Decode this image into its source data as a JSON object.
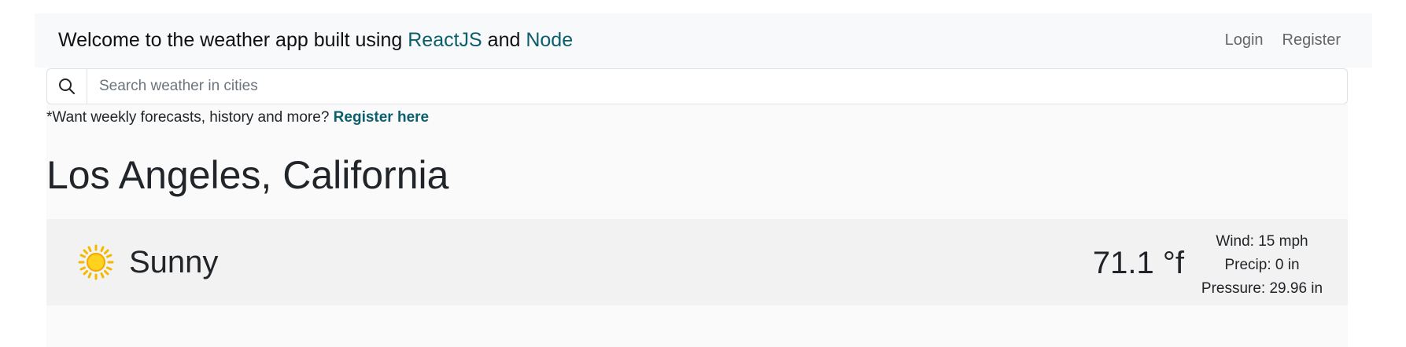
{
  "navbar": {
    "brand_prefix": "Welcome to the weather app built using ",
    "brand_link1": "ReactJS",
    "brand_mid": " and ",
    "brand_link2": "Node",
    "login": "Login",
    "register": "Register"
  },
  "search": {
    "placeholder": "Search weather in cities",
    "icon": "search-icon"
  },
  "promo": {
    "text": "*Want weekly forecasts, history and more? ",
    "link": "Register here"
  },
  "location": {
    "title": "Los Angeles, California"
  },
  "weather": {
    "icon": "sun-icon",
    "condition": "Sunny",
    "temperature": "71.1 °f",
    "wind": "Wind: 15 mph",
    "precip": "Precip: 0 in",
    "pressure": "Pressure: 29.96 in"
  },
  "colors": {
    "accent": "#0b5e6b",
    "navbar_bg": "#f8f9fa",
    "card_bg": "#f2f2f2",
    "sun": "#f5c518"
  }
}
